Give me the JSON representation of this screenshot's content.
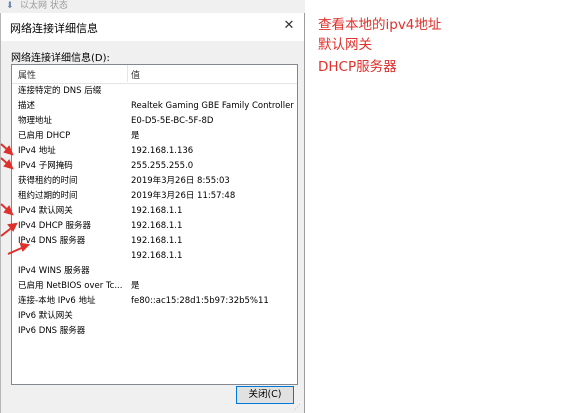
{
  "background_window": {
    "title": "以太网 状态"
  },
  "dialog": {
    "title": "网络连接详细信息",
    "close_glyph": "✕",
    "section_label": "网络连接详细信息(D):",
    "columns": {
      "property": "属性",
      "value": "值"
    },
    "rows": [
      {
        "property": "连接特定的 DNS 后缀",
        "value": ""
      },
      {
        "property": "描述",
        "value": "Realtek Gaming GBE Family Controller"
      },
      {
        "property": "物理地址",
        "value": "E0-D5-5E-BC-5F-8D"
      },
      {
        "property": "已启用 DHCP",
        "value": "是"
      },
      {
        "property": "IPv4 地址",
        "value": "192.168.1.136"
      },
      {
        "property": "IPv4 子网掩码",
        "value": "255.255.255.0"
      },
      {
        "property": "获得租约的时间",
        "value": "2019年3月26日 8:55:03"
      },
      {
        "property": "租约过期的时间",
        "value": "2019年3月26日 11:57:48"
      },
      {
        "property": "IPv4 默认网关",
        "value": "192.168.1.1"
      },
      {
        "property": "IPv4 DHCP 服务器",
        "value": "192.168.1.1"
      },
      {
        "property": "IPv4 DNS 服务器",
        "value": "192.168.1.1"
      },
      {
        "property": "",
        "value": "192.168.1.1"
      },
      {
        "property": "IPv4 WINS 服务器",
        "value": ""
      },
      {
        "property": "已启用 NetBIOS over Tc...",
        "value": "是"
      },
      {
        "property": "连接-本地 IPv6 地址",
        "value": "fe80::ac15:28d1:5b97:32b5%11"
      },
      {
        "property": "IPv6 默认网关",
        "value": ""
      },
      {
        "property": "IPv6 DNS 服务器",
        "value": ""
      }
    ],
    "close_button": "关闭(C)"
  },
  "annotations": [
    "查看本地的ipv4地址",
    "默认网关",
    "DHCP服务器"
  ],
  "colors": {
    "annotation": "#e0302b",
    "focus_border": "#0078d7"
  }
}
